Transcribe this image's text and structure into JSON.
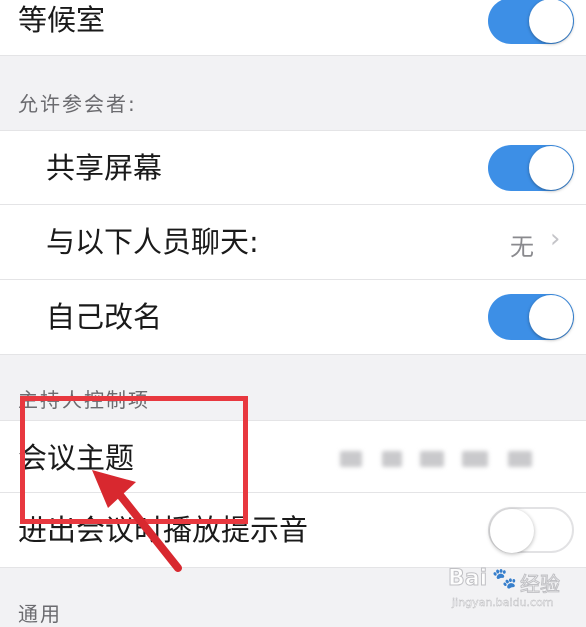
{
  "rows": {
    "waiting_room": "等候室",
    "share_screen": "共享屏幕",
    "chat_with": "与以下人员聊天:",
    "chat_with_value": "无",
    "rename_self": "自己改名",
    "meeting_topic": "会议主题",
    "entry_exit_sound": "进出会议时播放提示音"
  },
  "sections": {
    "allow_participants": "允许参会者:",
    "host_controls": "主持人控制项",
    "general": "通用"
  },
  "toggles": {
    "waiting_room": "on",
    "share_screen": "on",
    "rename_self": "on",
    "entry_exit_sound": "off"
  },
  "colors": {
    "toggle_on": "#3d8fe6",
    "highlight": "#e8383f"
  },
  "watermark": {
    "brand": "Bai",
    "suffix": "经验",
    "url": "jingyan.baidu.com"
  }
}
